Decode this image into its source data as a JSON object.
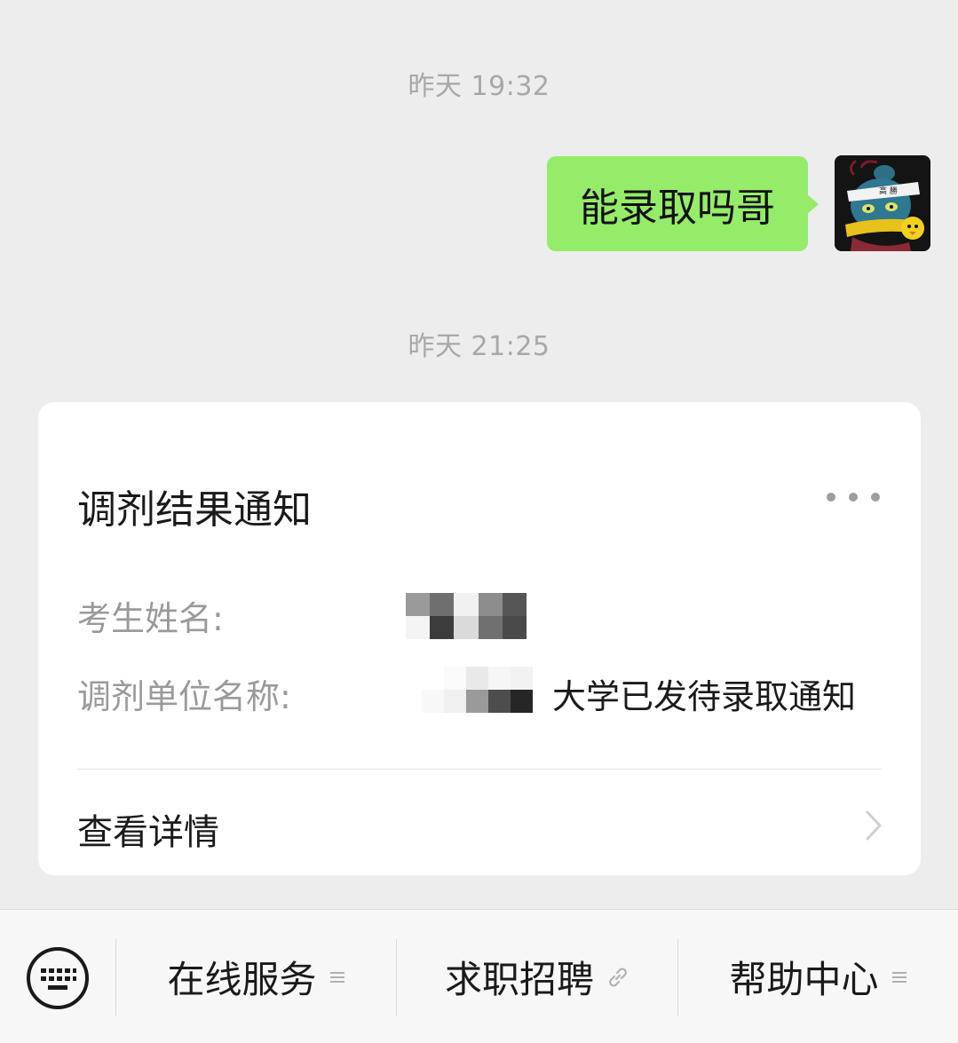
{
  "chat": {
    "timestamp_1": "昨天 19:32",
    "outgoing_message": "能录取吗哥",
    "timestamp_2": "昨天 21:25"
  },
  "card": {
    "title": "调剂结果通知",
    "fields": [
      {
        "label": "考生姓名:",
        "value": ""
      },
      {
        "label": "调剂单位名称:",
        "value": "大学已发待录取通知"
      }
    ],
    "link_label": "查看详情"
  },
  "bottom_menu": {
    "keyboard_icon": "keyboard-icon",
    "items": [
      {
        "label": "在线服务",
        "icon": "submenu-icon"
      },
      {
        "label": "求职招聘",
        "icon": "link-icon"
      },
      {
        "label": "帮助中心",
        "icon": "submenu-icon"
      }
    ]
  },
  "colors": {
    "background": "#ededed",
    "bubble_outgoing": "#95ec69",
    "card": "#ffffff",
    "muted_text": "#9a9a9a"
  }
}
